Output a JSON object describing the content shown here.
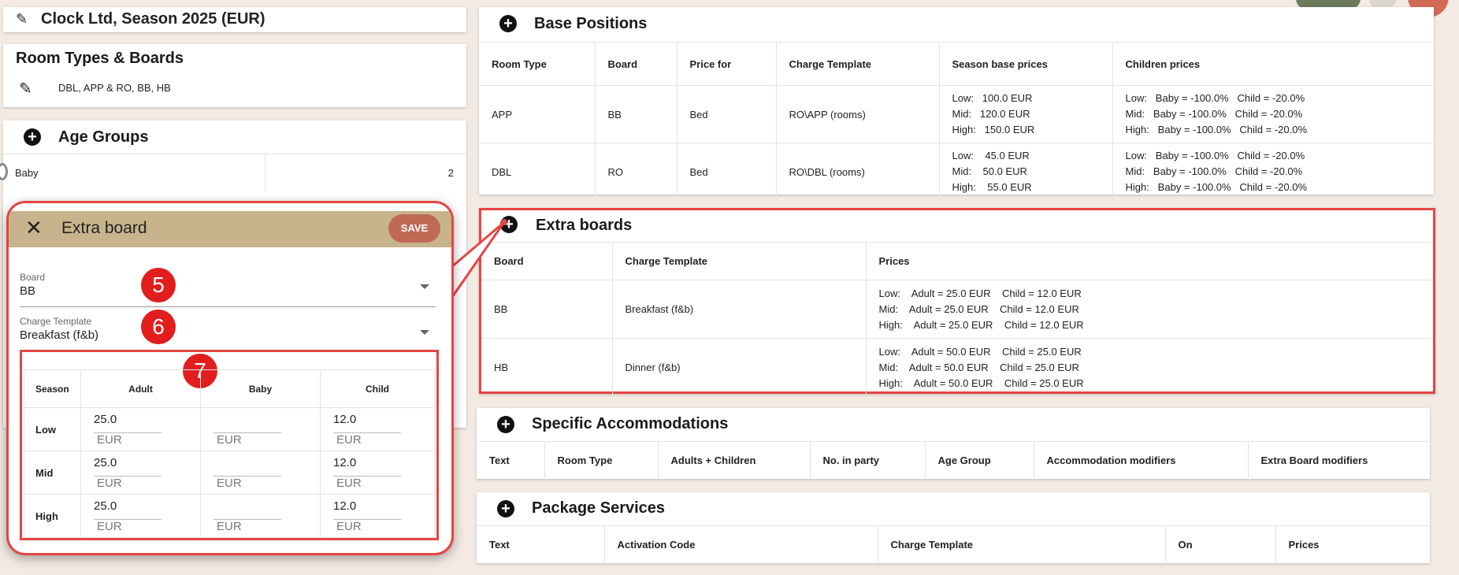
{
  "header": {
    "season_title": "Clock Ltd, Season 2025 (EUR)"
  },
  "room_types": {
    "title": "Room Types & Boards",
    "summary": "DBL, APP & RO, BB, HB"
  },
  "age_groups": {
    "title": "Age Groups",
    "rows": [
      {
        "name": "Baby",
        "value": "2"
      }
    ]
  },
  "base_positions": {
    "title": "Base Positions",
    "columns": [
      "Room Type",
      "Board",
      "Price for",
      "Charge Template",
      "Season base prices",
      "Children prices"
    ],
    "rows": [
      {
        "room_type": "APP",
        "board": "BB",
        "price_for": "Bed",
        "template": "RO\\APP (rooms)",
        "prices": [
          "Low:   100.0 EUR",
          "Mid:   120.0 EUR",
          "High:   150.0 EUR"
        ],
        "children": [
          "Low:   Baby = -100.0%   Child = -20.0%",
          "Mid:   Baby = -100.0%   Child = -20.0%",
          "High:   Baby = -100.0%   Child = -20.0%"
        ]
      },
      {
        "room_type": "DBL",
        "board": "RO",
        "price_for": "Bed",
        "template": "RO\\DBL (rooms)",
        "prices": [
          "Low:    45.0 EUR",
          "Mid:    50.0 EUR",
          "High:    55.0 EUR"
        ],
        "children": [
          "Low:   Baby = -100.0%   Child = -20.0%",
          "Mid:   Baby = -100.0%   Child = -20.0%",
          "High:   Baby = -100.0%   Child = -20.0%"
        ]
      }
    ]
  },
  "extra_boards": {
    "title": "Extra boards",
    "columns": [
      "Board",
      "Charge Template",
      "Prices"
    ],
    "rows": [
      {
        "board": "BB",
        "template": "Breakfast (f&b)",
        "prices": [
          "Low:    Adult = 25.0 EUR    Child = 12.0 EUR",
          "Mid:    Adult = 25.0 EUR    Child = 12.0 EUR",
          "High:    Adult = 25.0 EUR    Child = 12.0 EUR"
        ]
      },
      {
        "board": "HB",
        "template": "Dinner (f&b)",
        "prices": [
          "Low:    Adult = 50.0 EUR    Child = 25.0 EUR",
          "Mid:    Adult = 50.0 EUR    Child = 25.0 EUR",
          "High:    Adult = 50.0 EUR    Child = 25.0 EUR"
        ]
      }
    ]
  },
  "specific_accommodations": {
    "title": "Specific Accommodations",
    "columns": [
      "Text",
      "Room Type",
      "Adults + Children",
      "No. in party",
      "Age Group",
      "Accommodation modifiers",
      "Extra Board modifiers"
    ]
  },
  "package_services": {
    "title": "Package Services",
    "columns": [
      "Text",
      "Activation Code",
      "Charge Template",
      "On",
      "Prices"
    ]
  },
  "modal": {
    "title": "Extra board",
    "save_label": "SAVE",
    "board_label": "Board",
    "board_value": "BB",
    "template_label": "Charge Template",
    "template_value": "Breakfast (f&b)",
    "badges": [
      "5",
      "6",
      "7"
    ],
    "columns": [
      "Season",
      "Adult",
      "Baby",
      "Child"
    ],
    "currency": "EUR",
    "rows": [
      {
        "season": "Low",
        "adult": "25.0",
        "baby": "",
        "child": "12.0"
      },
      {
        "season": "Mid",
        "adult": "25.0",
        "baby": "",
        "child": "12.0"
      },
      {
        "season": "High",
        "adult": "25.0",
        "baby": "",
        "child": "12.0"
      }
    ]
  },
  "colors": {
    "accent_header": "#c8b48c",
    "save_button": "#c06a55",
    "highlight": "#e54545",
    "badge": "#e11d1d"
  }
}
